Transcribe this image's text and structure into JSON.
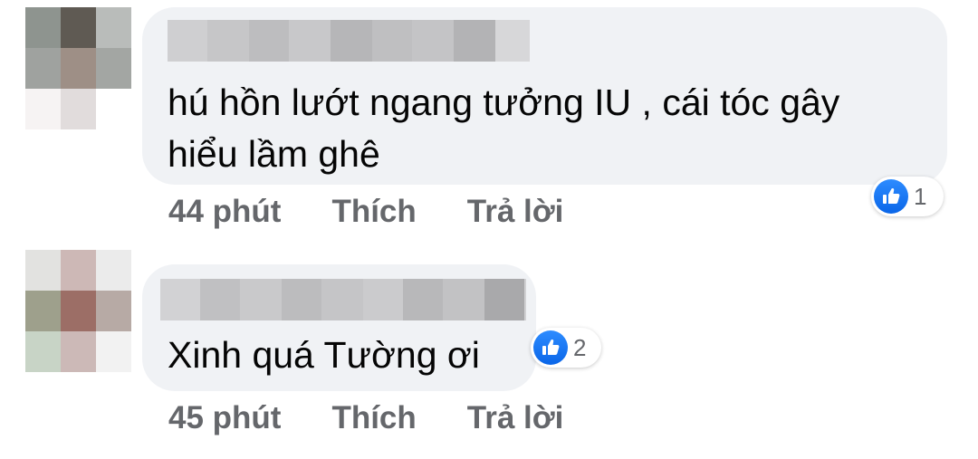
{
  "comments": [
    {
      "author_name": "",
      "text": "hú hồn lướt ngang tưởng IU , cái tóc gây\nhiểu lầm ghê",
      "reaction_count": "1",
      "time": "44 phút",
      "like_label": "Thích",
      "reply_label": "Trả lời",
      "avatar_colors": [
        "#8e948f",
        "#5f5a53",
        "#b9bcba",
        "#9fa29f",
        "#9e8f86",
        "#a3a6a3",
        "#f6f3f3",
        "#e1dcdc",
        "#ffffff"
      ],
      "name_colors": [
        "#cfcfd1",
        "#c6c6c8",
        "#bdbdbf",
        "#c8c8ca",
        "#b6b6b8",
        "#bfbfc1",
        "#c4c4c6",
        "#b3b3b5",
        "#d7d7d9"
      ]
    },
    {
      "author_name": "",
      "text": "Xinh quá Tường ơi",
      "reaction_count": "2",
      "time": "45 phút",
      "like_label": "Thích",
      "reply_label": "Trả lời",
      "avatar_colors": [
        "#e2e2e0",
        "#cdb8b6",
        "#ebebeb",
        "#9ea08c",
        "#9c6e66",
        "#b7aaa5",
        "#c8d4c6",
        "#ccb9b7",
        "#f2f2f2"
      ],
      "name_colors": [
        "#d2d2d4",
        "#c0c0c2",
        "#c9c9cb",
        "#bcbcbe",
        "#c5c5c7",
        "#cbcbcd",
        "#b8b8ba",
        "#c2c2c4",
        "#a9a9ab",
        "#d1d1d3"
      ]
    }
  ],
  "icons": {
    "like": "thumbs-up-icon"
  },
  "colors": {
    "bubble": "#f0f2f5",
    "meta_text": "#65676b",
    "like_blue": "#1877f2"
  }
}
